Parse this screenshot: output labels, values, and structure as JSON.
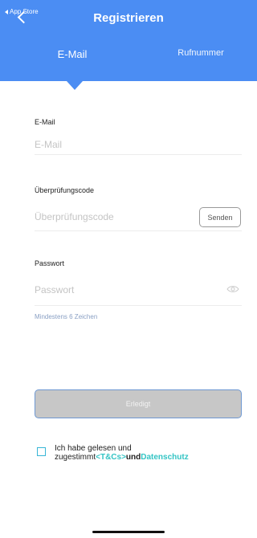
{
  "status_bar": {
    "back_app": "App Store"
  },
  "header": {
    "title": "Registrieren",
    "tabs": [
      {
        "label": "E-Mail",
        "active": true
      },
      {
        "label": "Rufnummer",
        "active": false
      }
    ]
  },
  "form": {
    "email": {
      "label": "E-Mail",
      "placeholder": "E-Mail"
    },
    "code": {
      "label": "Überprüfungscode",
      "placeholder": "Überprüfungscode",
      "send_label": "Senden"
    },
    "password": {
      "label": "Passwort",
      "placeholder": "Passwort",
      "hint": "Mindestens 6 Zeichen"
    },
    "done_label": "Erledigt"
  },
  "terms": {
    "line1": "Ich habe gelesen und",
    "line2_prefix": "zugestimmt",
    "tc_link": "<T&Cs>",
    "und": "und",
    "privacy_link": "Datenschutz",
    "checked": false
  },
  "colors": {
    "brand_blue": "#4b8df3",
    "link_teal": "#33c4c4",
    "button_disabled": "#c7c7c7"
  },
  "icons": {
    "back": "chevron-left-icon",
    "status_back": "triangle-left-icon",
    "password_visibility": "eye-icon"
  }
}
